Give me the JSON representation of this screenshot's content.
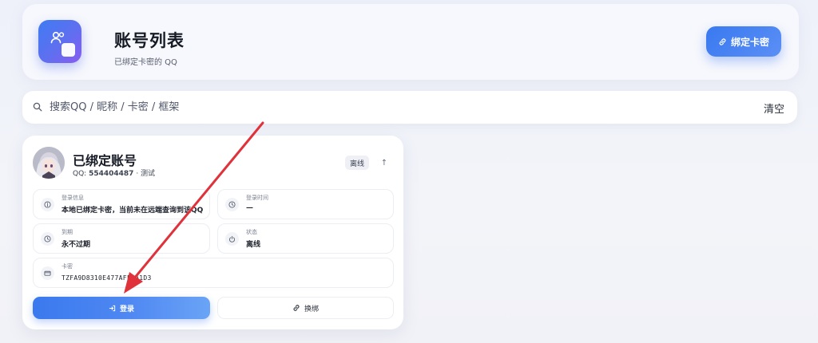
{
  "header": {
    "icon": "users-icon",
    "title": "账号列表",
    "subtitle": "已绑定卡密的 QQ",
    "bind_button": {
      "icon": "link-icon",
      "label": "绑定卡密"
    }
  },
  "search": {
    "icon": "search-icon",
    "placeholder": "搜索QQ / 昵称 / 卡密 / 框架",
    "value": "",
    "clear_label": "清空"
  },
  "account": {
    "name": "已绑定账号",
    "qq_label": "QQ:",
    "qq": "554404487",
    "qq_suffix": " · 测试",
    "status": "离线",
    "sort_icon": "arrow-up-icon",
    "fields": {
      "login_info": {
        "label": "登录信息",
        "value": "本地已绑定卡密，当前未在远端查询到该QQ",
        "icon": "info-icon"
      },
      "login_time": {
        "label": "登录时间",
        "value": "—",
        "icon": "clock-icon"
      },
      "expire": {
        "label": "到期",
        "value": "永不过期",
        "icon": "clock-icon"
      },
      "status": {
        "label": "状态",
        "value": "离线",
        "icon": "power-icon"
      },
      "card_key": {
        "label": "卡密",
        "value": "TZFA9D8310E477AFF0A1D3",
        "icon": "card-icon"
      }
    },
    "login_button": {
      "label": "登录",
      "icon": "login-icon"
    },
    "rebind_button": {
      "label": "换绑",
      "icon": "link-icon"
    }
  },
  "colors": {
    "accent": "#3979f0",
    "annotation_arrow": "#e0323a"
  }
}
